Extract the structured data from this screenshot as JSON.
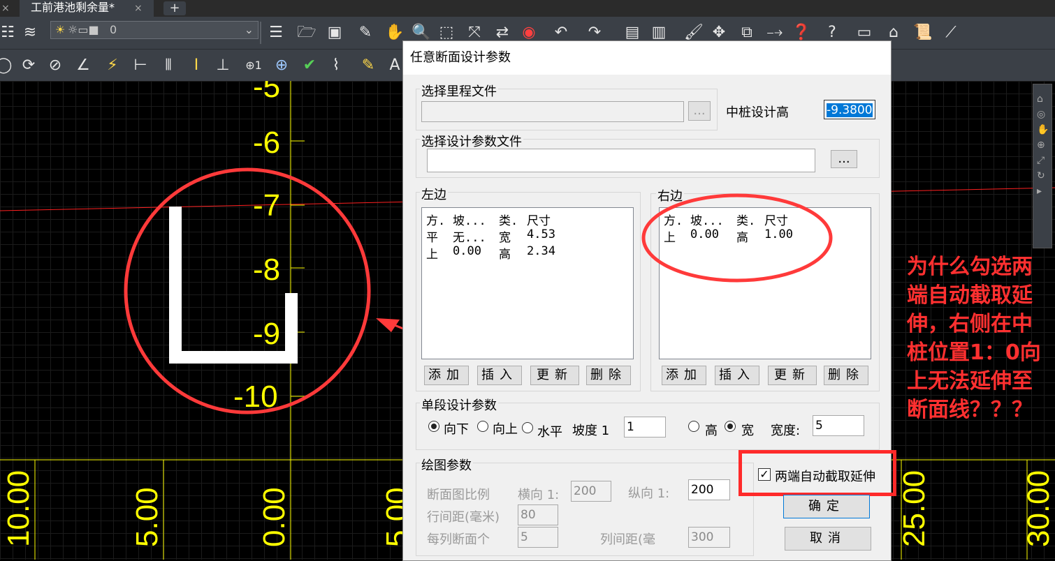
{
  "tabbar": {
    "active_tab": "工前港池剩余量*",
    "new_tab_symbol": "+",
    "close_symbol": "×"
  },
  "toolbar": {
    "layer_value": "0"
  },
  "canvas": {
    "y_axis_labels": [
      "-5",
      "-6",
      "-7",
      "-8",
      "-9",
      "-10"
    ],
    "x_axis_labels": [
      "10.00",
      "5.00",
      "0.00",
      "5.00",
      "25.00",
      "30.00"
    ],
    "colors": {
      "axis": "#ffff00",
      "profile": "#ffffff",
      "centerline": "#ff0000",
      "annotation": "#ff3030"
    }
  },
  "dialog": {
    "title": "任意断面设计参数",
    "mileage_file_label": "选择里程文件",
    "mileage_file_value": "",
    "browse_label": "...",
    "center_design_height_label": "中桩设计高",
    "center_design_height_value": "-9.3800",
    "design_param_file_label": "选择设计参数文件",
    "design_param_file_value": "",
    "left": {
      "group_label": "左边",
      "columns": [
        "方.",
        "坡...",
        "类.",
        "尺寸"
      ],
      "rows": [
        [
          "平",
          "无...",
          "宽",
          "4.53"
        ],
        [
          "上",
          "0.00",
          "高",
          "2.34"
        ]
      ],
      "buttons": [
        "添加",
        "插入",
        "更新",
        "删除"
      ]
    },
    "right": {
      "group_label": "右边",
      "columns": [
        "方.",
        "坡...",
        "类.",
        "尺寸"
      ],
      "rows": [
        [
          "上",
          "0.00",
          "高",
          "1.00"
        ]
      ],
      "buttons": [
        "添加",
        "插入",
        "更新",
        "删除"
      ]
    },
    "segment": {
      "group_label": "单段设计参数",
      "dir_down": "向下",
      "dir_up": "向上",
      "dir_flat": "水平",
      "slope_label": "坡度 1",
      "slope_value": "1",
      "height_label": "高",
      "width_label": "宽",
      "width_size_label": "宽度:",
      "width_size_value": "5"
    },
    "drawing": {
      "group_label": "绘图参数",
      "scale_label": "断面图比例",
      "horiz_label": "横向 1:",
      "horiz_value": "200",
      "vert_label": "纵向  1:",
      "vert_value": "200",
      "row_gap_label": "行间距(毫米)",
      "row_gap_value": "80",
      "per_col_label": "每列断面个",
      "per_col_value": "5",
      "col_gap_label": "列间距(毫",
      "col_gap_value": "300"
    },
    "auto_clip_label": "两端自动截取延伸",
    "auto_clip_checked": true,
    "ok_label": "确定",
    "cancel_label": "取消"
  },
  "annotation": {
    "lines": [
      "为什么勾选两",
      "端自动截取延",
      "伸，右侧在中",
      "桩位置1：0向",
      "上无法延伸至",
      "断面线？？？"
    ]
  }
}
